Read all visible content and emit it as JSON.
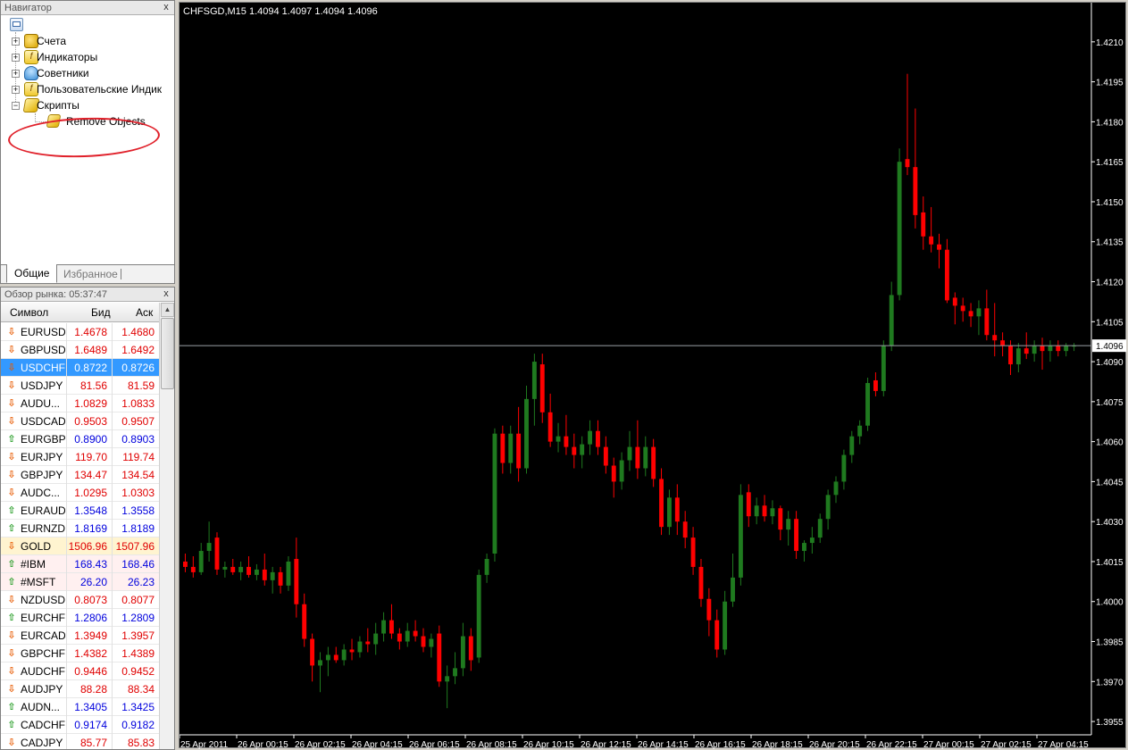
{
  "navigator": {
    "title": "Навигатор",
    "close": "x",
    "items": [
      {
        "label": "Счета",
        "icon": "accounts-icon"
      },
      {
        "label": "Индикаторы",
        "icon": "indicators-icon"
      },
      {
        "label": "Советники",
        "icon": "experts-icon"
      },
      {
        "label": "Пользовательские Индик",
        "icon": "custom-indicators-icon"
      },
      {
        "label": "Скрипты",
        "icon": "scripts-icon"
      }
    ],
    "script_child": "Remove Objects",
    "tabs": [
      "Общие",
      "Избранное"
    ]
  },
  "market_watch": {
    "title": "Обзор рынка: 05:37:47",
    "close": "x",
    "columns": [
      "Символ",
      "Бид",
      "Аск"
    ],
    "rows": [
      {
        "symbol": "EURUSD",
        "bid": "1.4678",
        "ask": "1.4680",
        "dir": "down",
        "color": "red"
      },
      {
        "symbol": "GBPUSD",
        "bid": "1.6489",
        "ask": "1.6492",
        "dir": "down",
        "color": "red"
      },
      {
        "symbol": "USDCHF",
        "bid": "0.8722",
        "ask": "0.8726",
        "dir": "down",
        "color": "red",
        "selected": true
      },
      {
        "symbol": "USDJPY",
        "bid": "81.56",
        "ask": "81.59",
        "dir": "down",
        "color": "red"
      },
      {
        "symbol": "AUDU...",
        "bid": "1.0829",
        "ask": "1.0833",
        "dir": "down",
        "color": "red"
      },
      {
        "symbol": "USDCAD",
        "bid": "0.9503",
        "ask": "0.9507",
        "dir": "down",
        "color": "red"
      },
      {
        "symbol": "EURGBP",
        "bid": "0.8900",
        "ask": "0.8903",
        "dir": "up",
        "color": "blue"
      },
      {
        "symbol": "EURJPY",
        "bid": "119.70",
        "ask": "119.74",
        "dir": "down",
        "color": "red"
      },
      {
        "symbol": "GBPJPY",
        "bid": "134.47",
        "ask": "134.54",
        "dir": "down",
        "color": "red"
      },
      {
        "symbol": "AUDC...",
        "bid": "1.0295",
        "ask": "1.0303",
        "dir": "down",
        "color": "red"
      },
      {
        "symbol": "EURAUD",
        "bid": "1.3548",
        "ask": "1.3558",
        "dir": "up",
        "color": "blue"
      },
      {
        "symbol": "EURNZD",
        "bid": "1.8169",
        "ask": "1.8189",
        "dir": "up",
        "color": "blue"
      },
      {
        "symbol": "GOLD",
        "bid": "1506.96",
        "ask": "1507.96",
        "dir": "down",
        "color": "red",
        "kind": "gold"
      },
      {
        "symbol": "#IBM",
        "bid": "168.43",
        "ask": "168.46",
        "dir": "up",
        "color": "blue",
        "kind": "cfd"
      },
      {
        "symbol": "#MSFT",
        "bid": "26.20",
        "ask": "26.23",
        "dir": "up",
        "color": "blue",
        "kind": "cfd"
      },
      {
        "symbol": "NZDUSD",
        "bid": "0.8073",
        "ask": "0.8077",
        "dir": "down",
        "color": "red"
      },
      {
        "symbol": "EURCHF",
        "bid": "1.2806",
        "ask": "1.2809",
        "dir": "up",
        "color": "blue"
      },
      {
        "symbol": "EURCAD",
        "bid": "1.3949",
        "ask": "1.3957",
        "dir": "down",
        "color": "red"
      },
      {
        "symbol": "GBPCHF",
        "bid": "1.4382",
        "ask": "1.4389",
        "dir": "down",
        "color": "red"
      },
      {
        "symbol": "AUDCHF",
        "bid": "0.9446",
        "ask": "0.9452",
        "dir": "down",
        "color": "red"
      },
      {
        "symbol": "AUDJPY",
        "bid": "88.28",
        "ask": "88.34",
        "dir": "down",
        "color": "red"
      },
      {
        "symbol": "AUDN...",
        "bid": "1.3405",
        "ask": "1.3425",
        "dir": "up",
        "color": "blue"
      },
      {
        "symbol": "CADCHF",
        "bid": "0.9174",
        "ask": "0.9182",
        "dir": "up",
        "color": "blue"
      },
      {
        "symbol": "CADJPY",
        "bid": "85.77",
        "ask": "85.83",
        "dir": "down",
        "color": "red"
      }
    ]
  },
  "chart": {
    "title": "CHFSGD,M15  1.4094 1.4097 1.4094 1.4096",
    "current_price": "1.4096",
    "colors": {
      "bull": "#1f7a1f",
      "bear": "#ff0000",
      "background": "#000000",
      "axis": "#ffffff",
      "price_line": "#9aa0a6"
    }
  },
  "chart_data": {
    "type": "candlestick",
    "title": "CHFSGD,M15  1.4094 1.4097 1.4094 1.4096",
    "ylim": [
      1.395,
      1.422
    ],
    "yticks": [
      "1.4210",
      "1.4195",
      "1.4180",
      "1.4165",
      "1.4150",
      "1.4135",
      "1.4120",
      "1.4105",
      "1.4090",
      "1.4075",
      "1.4060",
      "1.4045",
      "1.4030",
      "1.4015",
      "1.4000",
      "1.3985",
      "1.3970",
      "1.3955"
    ],
    "xticks": [
      "25 Apr 2011",
      "26 Apr 00:15",
      "26 Apr 02:15",
      "26 Apr 04:15",
      "26 Apr 06:15",
      "26 Apr 08:15",
      "26 Apr 10:15",
      "26 Apr 12:15",
      "26 Apr 14:15",
      "26 Apr 16:15",
      "26 Apr 18:15",
      "26 Apr 20:15",
      "26 Apr 22:15",
      "27 Apr 00:15",
      "27 Apr 02:15",
      "27 Apr 04:15"
    ],
    "last_price": 1.4096,
    "candles": [
      [
        1.4015,
        1.4018,
        1.4011,
        1.4013
      ],
      [
        1.4013,
        1.4017,
        1.4009,
        1.4011
      ],
      [
        1.4011,
        1.4022,
        1.401,
        1.4019
      ],
      [
        1.4019,
        1.403,
        1.4015,
        1.4022
      ],
      [
        1.4024,
        1.4026,
        1.401,
        1.4012
      ],
      [
        1.4012,
        1.4015,
        1.4009,
        1.4013
      ],
      [
        1.4013,
        1.4016,
        1.401,
        1.4011
      ],
      [
        1.4011,
        1.4015,
        1.4008,
        1.4013
      ],
      [
        1.4013,
        1.4017,
        1.4009,
        1.401
      ],
      [
        1.401,
        1.4014,
        1.4008,
        1.4012
      ],
      [
        1.4012,
        1.4018,
        1.4006,
        1.4008
      ],
      [
        1.4008,
        1.4013,
        1.4003,
        1.4011
      ],
      [
        1.4011,
        1.4013,
        1.4003,
        1.4006
      ],
      [
        1.4006,
        1.4017,
        1.4004,
        1.4015
      ],
      [
        1.4016,
        1.4024,
        1.3994,
        1.3999
      ],
      [
        1.3999,
        1.4003,
        1.3983,
        1.3986
      ],
      [
        1.3986,
        1.3988,
        1.397,
        1.3976
      ],
      [
        1.3976,
        1.3981,
        1.3966,
        1.3978
      ],
      [
        1.3978,
        1.3983,
        1.3972,
        1.398
      ],
      [
        1.398,
        1.3983,
        1.3977,
        1.3978
      ],
      [
        1.3978,
        1.3984,
        1.3976,
        1.3982
      ],
      [
        1.3982,
        1.3986,
        1.3978,
        1.3981
      ],
      [
        1.3981,
        1.3987,
        1.3979,
        1.3985
      ],
      [
        1.3985,
        1.399,
        1.3981,
        1.3984
      ],
      [
        1.3984,
        1.3992,
        1.398,
        1.3988
      ],
      [
        1.3988,
        1.3996,
        1.3985,
        1.3993
      ],
      [
        1.3993,
        1.3999,
        1.3986,
        1.3988
      ],
      [
        1.3988,
        1.399,
        1.3982,
        1.3985
      ],
      [
        1.3985,
        1.3992,
        1.3983,
        1.3989
      ],
      [
        1.3989,
        1.3993,
        1.3985,
        1.3987
      ],
      [
        1.3987,
        1.399,
        1.3981,
        1.3983
      ],
      [
        1.3983,
        1.3988,
        1.3979,
        1.3986
      ],
      [
        1.3988,
        1.3991,
        1.3968,
        1.397
      ],
      [
        1.397,
        1.3976,
        1.396,
        1.3972
      ],
      [
        1.3972,
        1.3981,
        1.3969,
        1.3975
      ],
      [
        1.3975,
        1.3992,
        1.3972,
        1.3987
      ],
      [
        1.3987,
        1.399,
        1.3974,
        1.3978
      ],
      [
        1.3979,
        1.4012,
        1.3977,
        1.401
      ],
      [
        1.401,
        1.4018,
        1.4007,
        1.4016
      ],
      [
        1.4018,
        1.4065,
        1.4015,
        1.4063
      ],
      [
        1.4063,
        1.4066,
        1.4048,
        1.4052
      ],
      [
        1.4052,
        1.4066,
        1.4048,
        1.4063
      ],
      [
        1.4063,
        1.4073,
        1.4045,
        1.405
      ],
      [
        1.405,
        1.4081,
        1.4048,
        1.4076
      ],
      [
        1.4076,
        1.4093,
        1.4066,
        1.409
      ],
      [
        1.4089,
        1.4093,
        1.4067,
        1.4071
      ],
      [
        1.4071,
        1.4078,
        1.4058,
        1.406
      ],
      [
        1.406,
        1.4067,
        1.4056,
        1.4062
      ],
      [
        1.4062,
        1.407,
        1.4055,
        1.4058
      ],
      [
        1.4058,
        1.4063,
        1.405,
        1.4055
      ],
      [
        1.4055,
        1.4062,
        1.405,
        1.4059
      ],
      [
        1.4059,
        1.4068,
        1.4055,
        1.4064
      ],
      [
        1.4064,
        1.4068,
        1.4055,
        1.4058
      ],
      [
        1.4058,
        1.4062,
        1.4048,
        1.4051
      ],
      [
        1.4051,
        1.4054,
        1.4039,
        1.4045
      ],
      [
        1.4045,
        1.4056,
        1.4042,
        1.4053
      ],
      [
        1.4053,
        1.4064,
        1.4049,
        1.4058
      ],
      [
        1.4058,
        1.4068,
        1.4046,
        1.405
      ],
      [
        1.405,
        1.4062,
        1.4047,
        1.4058
      ],
      [
        1.4058,
        1.4061,
        1.4043,
        1.4046
      ],
      [
        1.4046,
        1.405,
        1.4025,
        1.4028
      ],
      [
        1.4028,
        1.4042,
        1.4025,
        1.4039
      ],
      [
        1.4039,
        1.4044,
        1.4025,
        1.403
      ],
      [
        1.403,
        1.4034,
        1.402,
        1.4024
      ],
      [
        1.4024,
        1.4028,
        1.401,
        1.4013
      ],
      [
        1.4013,
        1.4016,
        1.3998,
        1.4001
      ],
      [
        1.4001,
        1.4005,
        1.3987,
        1.3993
      ],
      [
        1.3993,
        1.3997,
        1.3979,
        1.3982
      ],
      [
        1.3982,
        1.4004,
        1.398,
        1.4
      ],
      [
        1.4,
        1.4018,
        1.3998,
        1.4009
      ],
      [
        1.4009,
        1.4044,
        1.4006,
        1.404
      ],
      [
        1.4041,
        1.4044,
        1.4028,
        1.4032
      ],
      [
        1.4032,
        1.4039,
        1.4029,
        1.4036
      ],
      [
        1.4036,
        1.404,
        1.403,
        1.4032
      ],
      [
        1.4032,
        1.4038,
        1.4029,
        1.4035
      ],
      [
        1.4035,
        1.4036,
        1.4023,
        1.4027
      ],
      [
        1.4027,
        1.4034,
        1.4021,
        1.4031
      ],
      [
        1.4031,
        1.4034,
        1.4016,
        1.4019
      ],
      [
        1.4019,
        1.4023,
        1.4015,
        1.4022
      ],
      [
        1.4022,
        1.4028,
        1.4018,
        1.4024
      ],
      [
        1.4024,
        1.4033,
        1.4022,
        1.4031
      ],
      [
        1.4031,
        1.4042,
        1.4027,
        1.404
      ],
      [
        1.404,
        1.4047,
        1.4037,
        1.4045
      ],
      [
        1.4045,
        1.4057,
        1.4042,
        1.4055
      ],
      [
        1.4055,
        1.4064,
        1.4052,
        1.4062
      ],
      [
        1.4062,
        1.4068,
        1.4059,
        1.4066
      ],
      [
        1.4066,
        1.4084,
        1.4064,
        1.4082
      ],
      [
        1.4083,
        1.4086,
        1.4077,
        1.4079
      ],
      [
        1.4079,
        1.4098,
        1.4077,
        1.4096
      ],
      [
        1.4096,
        1.412,
        1.4094,
        1.4115
      ],
      [
        1.4115,
        1.417,
        1.4113,
        1.4165
      ],
      [
        1.4166,
        1.4198,
        1.416,
        1.4163
      ],
      [
        1.4163,
        1.4185,
        1.414,
        1.4145
      ],
      [
        1.4146,
        1.4152,
        1.4132,
        1.4137
      ],
      [
        1.4137,
        1.4148,
        1.4131,
        1.4134
      ],
      [
        1.4134,
        1.4138,
        1.4125,
        1.4132
      ],
      [
        1.4132,
        1.4136,
        1.4112,
        1.4113
      ],
      [
        1.4114,
        1.4116,
        1.4104,
        1.4111
      ],
      [
        1.4111,
        1.4114,
        1.4105,
        1.4109
      ],
      [
        1.4109,
        1.4112,
        1.4103,
        1.4107
      ],
      [
        1.4107,
        1.4113,
        1.41,
        1.411
      ],
      [
        1.411,
        1.4117,
        1.4098,
        1.41
      ],
      [
        1.41,
        1.4112,
        1.4092,
        1.4098
      ],
      [
        1.4098,
        1.4101,
        1.4092,
        1.4096
      ],
      [
        1.4096,
        1.4098,
        1.4085,
        1.4089
      ],
      [
        1.4089,
        1.4097,
        1.4086,
        1.4095
      ],
      [
        1.4095,
        1.4101,
        1.4091,
        1.4093
      ],
      [
        1.4093,
        1.4098,
        1.409,
        1.4096
      ],
      [
        1.4096,
        1.4099,
        1.4087,
        1.4094
      ],
      [
        1.4094,
        1.4098,
        1.409,
        1.4096
      ],
      [
        1.4096,
        1.4098,
        1.4092,
        1.4094
      ],
      [
        1.4094,
        1.4097,
        1.4092,
        1.4096
      ],
      [
        1.4096,
        1.4097,
        1.4094,
        1.4096
      ]
    ]
  }
}
